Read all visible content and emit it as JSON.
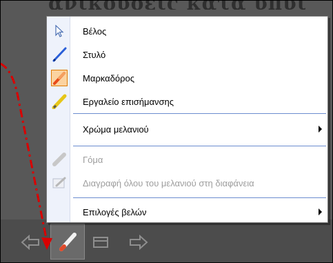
{
  "background": {
    "title_fragment": "ανικουοεις κατα υπυι"
  },
  "menu": {
    "items": [
      {
        "label": "Βέλος",
        "icon": "arrow-pointer-icon",
        "disabled": false,
        "checked": false,
        "submenu": false
      },
      {
        "label": "Στυλό",
        "icon": "pen-icon",
        "disabled": false,
        "checked": false,
        "submenu": false
      },
      {
        "label": "Μαρκαδόρος",
        "icon": "felt-tip-pen-icon",
        "disabled": false,
        "checked": true,
        "submenu": false
      },
      {
        "label": "Εργαλείο επισήμανσης",
        "icon": "highlighter-icon",
        "disabled": false,
        "checked": false,
        "submenu": false
      },
      {
        "label": "Χρώμα μελανιού",
        "icon": "",
        "disabled": false,
        "checked": false,
        "submenu": true
      },
      {
        "label": "Γόμα",
        "icon": "eraser-icon",
        "disabled": true,
        "checked": false,
        "submenu": false
      },
      {
        "label": "Διαγραφή όλου του μελανιού στη διαφάνεια",
        "icon": "erase-all-icon",
        "disabled": true,
        "checked": false,
        "submenu": false
      },
      {
        "label": "Επιλογές βελών",
        "icon": "",
        "disabled": false,
        "checked": false,
        "submenu": true
      }
    ]
  },
  "toolbar": {
    "buttons": [
      "previous-slide-icon",
      "pen-tool-icon",
      "slide-menu-icon",
      "next-slide-icon"
    ]
  },
  "colors": {
    "accent_orange": "#e07b00",
    "checked_bg": "#fbd3a0",
    "separator_blue": "#6b8ccf",
    "annotation_red": "#d90000"
  }
}
